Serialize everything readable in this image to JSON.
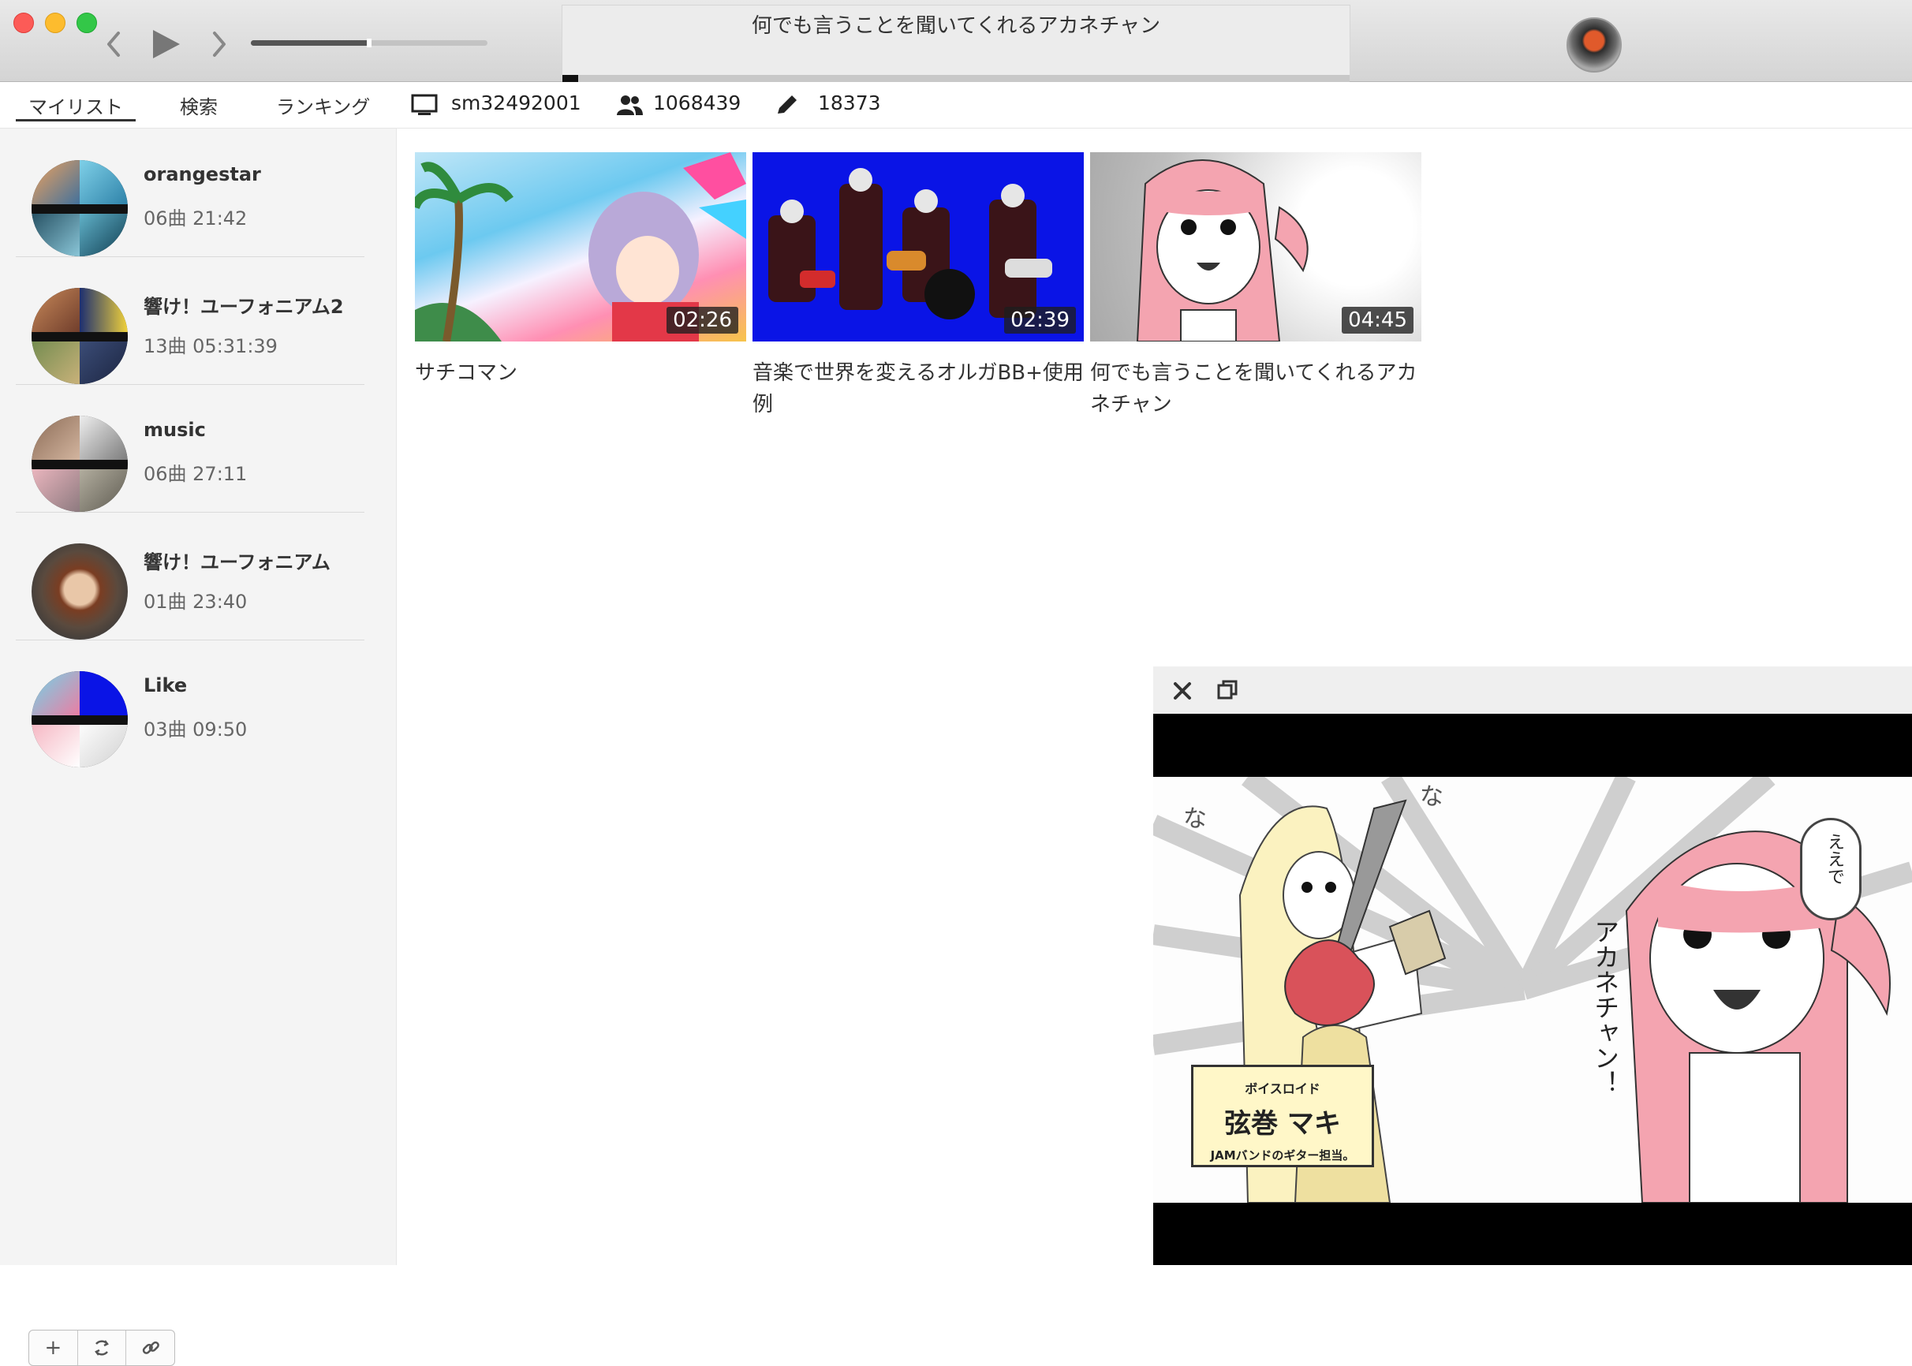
{
  "titlebar": {
    "now_playing_title": "何でも言うことを聞いてくれるアカネチャン",
    "volume_level": 0.5,
    "playback_progress": 0.02
  },
  "tabs": {
    "mylist": "マイリスト",
    "search": "検索",
    "ranking": "ランキング"
  },
  "info": {
    "video_id": "sm32492001",
    "views": "1068439",
    "comments": "18373"
  },
  "playlists": [
    {
      "name": "orangestar",
      "meta": "06曲 21:42"
    },
    {
      "name": "響け！ユーフォニアム2",
      "meta": "13曲 05:31:39"
    },
    {
      "name": "music",
      "meta": "06曲 27:11"
    },
    {
      "name": "響け！ユーフォニアム",
      "meta": "01曲 23:40"
    },
    {
      "name": "Like",
      "meta": "03曲 09:50"
    }
  ],
  "sidebar_buttons": {
    "add": "+"
  },
  "videos": [
    {
      "title": "サチコマン",
      "duration": "02:26"
    },
    {
      "title": "音楽で世界を変えるオルガBB+使用例",
      "duration": "02:39"
    },
    {
      "title": "何でも言うことを聞いてくれるアカネチャン",
      "duration": "04:45"
    }
  ],
  "mini_player": {
    "caption_top": "ボイスロイド",
    "caption_main": "弦巻 マキ",
    "caption_sub": "JAMバンドのギター担当。",
    "na_left": "な",
    "na_right": "な",
    "speech": "ええで",
    "vertical_text": "アカネチャン！"
  },
  "colors": {
    "close": "#fc5b57",
    "minimize": "#fdbc2e",
    "maximize": "#33c748",
    "sidebar_bg": "#f4f4f4",
    "band_blue": "#0a14e6"
  }
}
